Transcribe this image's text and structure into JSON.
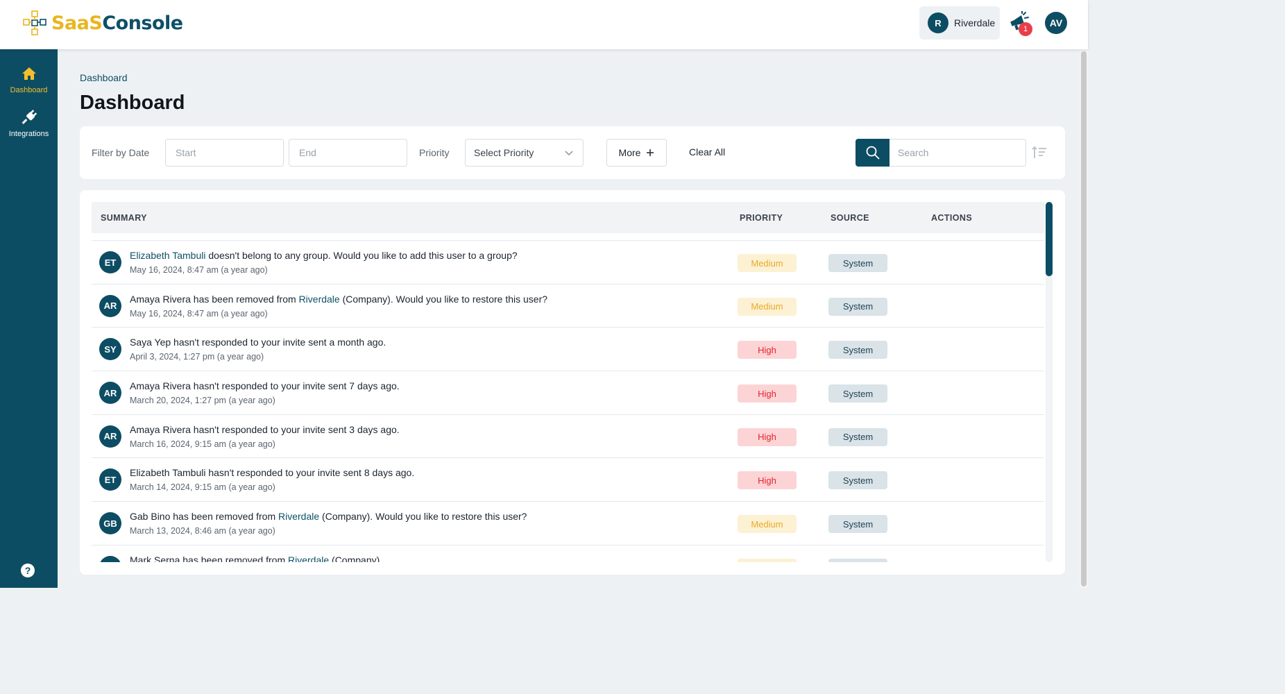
{
  "header": {
    "logo_part1": "SaaS",
    "logo_part2": "Console",
    "company": {
      "initial": "R",
      "name": "Riverdale"
    },
    "notifications": {
      "icon": "announcement-megaphone-icon",
      "count": "1"
    },
    "user_initials": "AV"
  },
  "sidebar": {
    "items": [
      {
        "label": "Dashboard",
        "icon": "home-icon",
        "active": true
      },
      {
        "label": "Integrations",
        "icon": "plug-icon",
        "active": false
      }
    ],
    "help_label": "?"
  },
  "breadcrumb": "Dashboard",
  "page_title": "Dashboard",
  "filters": {
    "date_label": "Filter by Date",
    "start_placeholder": "Start",
    "end_placeholder": "End",
    "priority_label": "Priority",
    "priority_select": "Select Priority",
    "more_label": "More",
    "clear_all": "Clear All",
    "search_placeholder": "Search"
  },
  "table": {
    "columns": [
      "SUMMARY",
      "PRIORITY",
      "SOURCE",
      "ACTIONS"
    ],
    "rows": [
      {
        "initials": "ET",
        "link1": "Elizabeth Tambuli",
        "text1": " doesn't belong to any group. Would you like to add this user to a group?",
        "link2": "",
        "text2": "",
        "date": "May 16, 2024, 8:47 am (a year ago)",
        "priority": "Medium",
        "source": "System"
      },
      {
        "initials": "AR",
        "link1": "",
        "text1": "Amaya Rivera has been removed from ",
        "link2": "Riverdale",
        "text2": " (Company). Would you like to restore this user?",
        "date": "May 16, 2024, 8:47 am (a year ago)",
        "priority": "Medium",
        "source": "System"
      },
      {
        "initials": "SY",
        "link1": "",
        "text1": "Saya Yep hasn't responded to your invite sent a month ago.",
        "link2": "",
        "text2": "",
        "date": "April 3, 2024, 1:27 pm (a year ago)",
        "priority": "High",
        "source": "System"
      },
      {
        "initials": "AR",
        "link1": "",
        "text1": "Amaya Rivera hasn't responded to your invite sent 7 days ago.",
        "link2": "",
        "text2": "",
        "date": "March 20, 2024, 1:27 pm (a year ago)",
        "priority": "High",
        "source": "System"
      },
      {
        "initials": "AR",
        "link1": "",
        "text1": "Amaya Rivera hasn't responded to your invite sent 3 days ago.",
        "link2": "",
        "text2": "",
        "date": "March 16, 2024, 9:15 am (a year ago)",
        "priority": "High",
        "source": "System"
      },
      {
        "initials": "ET",
        "link1": "",
        "text1": "Elizabeth Tambuli hasn't responded to your invite sent 8 days ago.",
        "link2": "",
        "text2": "",
        "date": "March 14, 2024, 9:15 am (a year ago)",
        "priority": "High",
        "source": "System"
      },
      {
        "initials": "GB",
        "link1": "",
        "text1": "Gab Bino has been removed from ",
        "link2": "Riverdale",
        "text2": " (Company). Would you like to restore this user?",
        "date": "March 13, 2024, 8:46 am (a year ago)",
        "priority": "Medium",
        "source": "System"
      },
      {
        "initials": "MS",
        "link1": "",
        "text1": "Mark Serna has been removed from ",
        "link2": "Riverdale",
        "text2": " (Company).",
        "date": "",
        "priority": "Medium",
        "source": "System"
      }
    ]
  },
  "colors": {
    "brand_teal": "#0d4d63",
    "brand_yellow": "#e9b620",
    "priority_medium_bg": "#fdf1d3",
    "priority_medium_text": "#e9a92a",
    "priority_high_bg": "#fcd4d6",
    "priority_high_text": "#e3242e"
  }
}
